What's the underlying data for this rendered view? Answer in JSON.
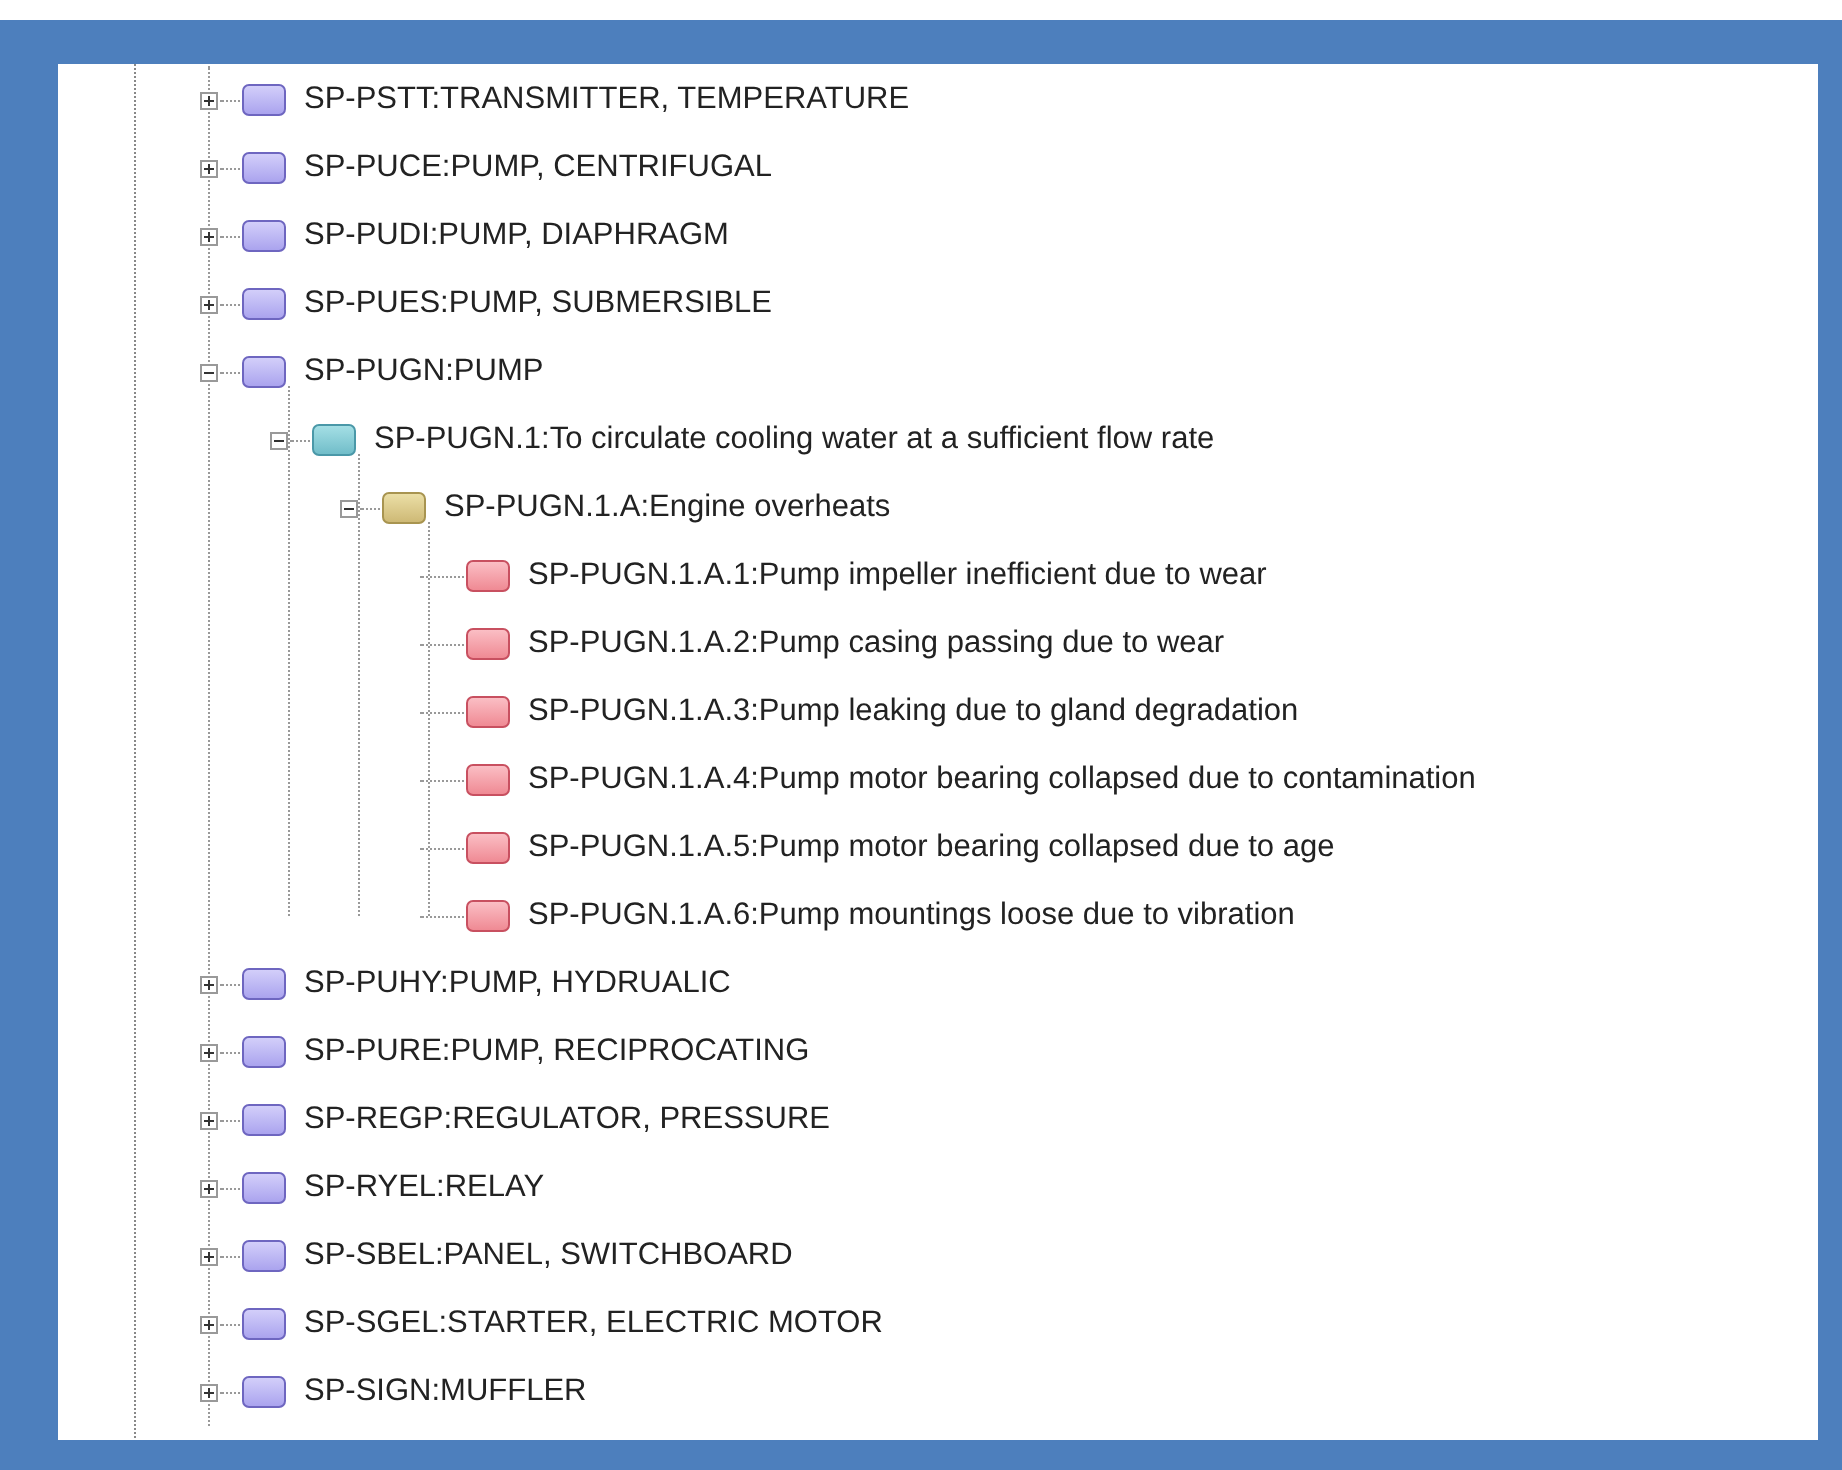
{
  "tree": {
    "items": [
      {
        "label": "SP-PSTT:TRANSMITTER, TEMPERATURE",
        "kind": "equipment",
        "expanded": false
      },
      {
        "label": "SP-PUCE:PUMP, CENTRIFUGAL",
        "kind": "equipment",
        "expanded": false
      },
      {
        "label": "SP-PUDI:PUMP, DIAPHRAGM",
        "kind": "equipment",
        "expanded": false
      },
      {
        "label": "SP-PUES:PUMP, SUBMERSIBLE",
        "kind": "equipment",
        "expanded": false
      },
      {
        "label": "SP-PUGN:PUMP",
        "kind": "equipment",
        "expanded": true,
        "children": [
          {
            "label": "SP-PUGN.1:To circulate cooling water at a sufficient flow rate",
            "kind": "function",
            "expanded": true,
            "children": [
              {
                "label": "SP-PUGN.1.A:Engine overheats",
                "kind": "failure",
                "expanded": true,
                "children": [
                  {
                    "label": "SP-PUGN.1.A.1:Pump impeller inefficient due to wear",
                    "kind": "cause"
                  },
                  {
                    "label": "SP-PUGN.1.A.2:Pump casing passing due to wear",
                    "kind": "cause"
                  },
                  {
                    "label": "SP-PUGN.1.A.3:Pump leaking due to gland degradation",
                    "kind": "cause"
                  },
                  {
                    "label": "SP-PUGN.1.A.4:Pump motor bearing collapsed due to contamination",
                    "kind": "cause"
                  },
                  {
                    "label": "SP-PUGN.1.A.5:Pump motor bearing collapsed due to age",
                    "kind": "cause"
                  },
                  {
                    "label": "SP-PUGN.1.A.6:Pump mountings loose due to vibration",
                    "kind": "cause"
                  }
                ]
              }
            ]
          }
        ]
      },
      {
        "label": "SP-PUHY:PUMP, HYDRUALIC",
        "kind": "equipment",
        "expanded": false
      },
      {
        "label": "SP-PURE:PUMP, RECIPROCATING",
        "kind": "equipment",
        "expanded": false
      },
      {
        "label": "SP-REGP:REGULATOR, PRESSURE",
        "kind": "equipment",
        "expanded": false
      },
      {
        "label": "SP-RYEL:RELAY",
        "kind": "equipment",
        "expanded": false
      },
      {
        "label": "SP-SBEL:PANEL, SWITCHBOARD",
        "kind": "equipment",
        "expanded": false
      },
      {
        "label": "SP-SGEL:STARTER, ELECTRIC MOTOR",
        "kind": "equipment",
        "expanded": false
      },
      {
        "label": "SP-SIGN:MUFFLER",
        "kind": "equipment",
        "expanded": false
      }
    ]
  }
}
